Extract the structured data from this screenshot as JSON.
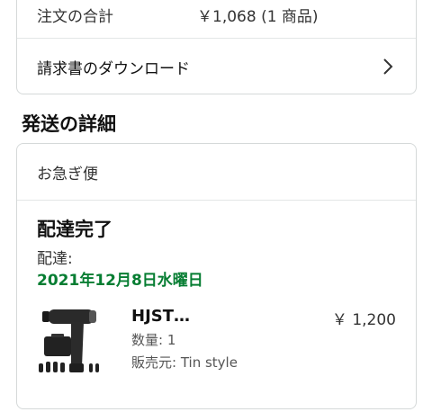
{
  "order_summary": {
    "total_label": "注文の合計",
    "total_value": "￥1,068 (1 商品)",
    "invoice_label": "請求書のダウンロード"
  },
  "shipping": {
    "section_title": "発送の詳細",
    "speed": "お急ぎ便",
    "status": "配達完了",
    "delivery_label": "配達:",
    "delivery_date": "2021年12月8日水曜日",
    "date_color": "#067d32"
  },
  "product": {
    "name": "HJST…",
    "price": "￥ 1,200",
    "quantity": "数量: 1",
    "seller": "販売元: Tin style",
    "image_icon": "massage-gun-image"
  }
}
